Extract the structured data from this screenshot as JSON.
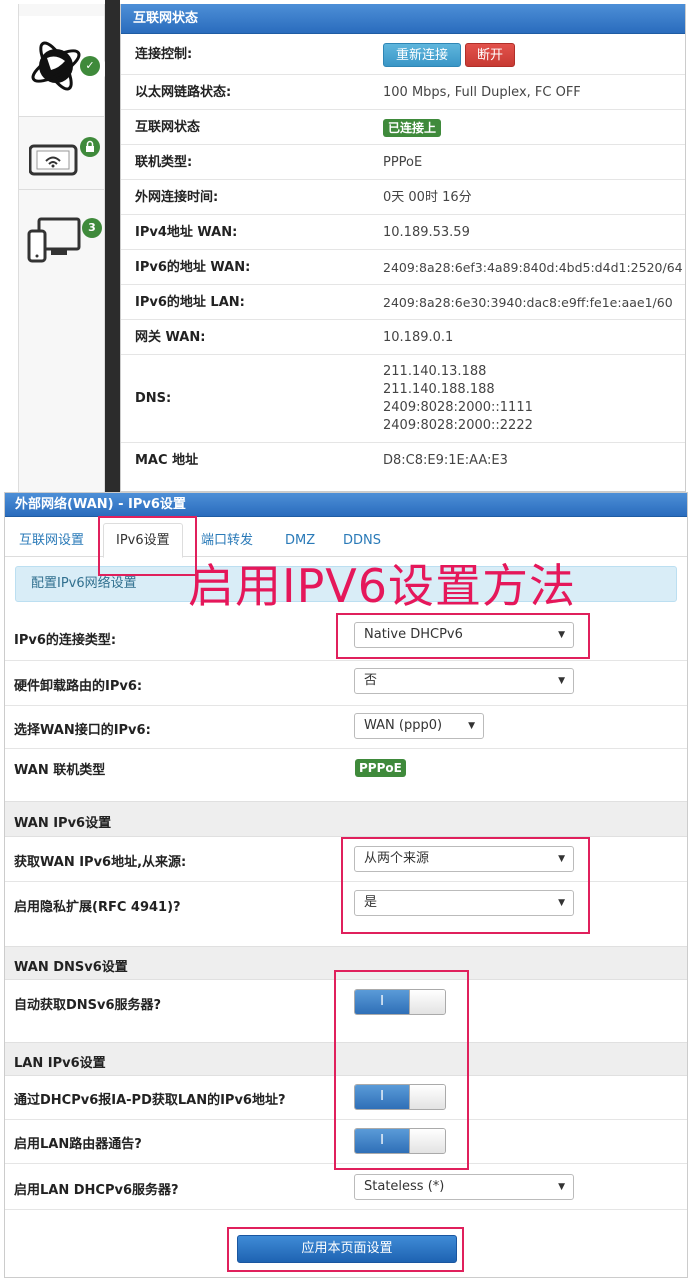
{
  "status": {
    "title": "互联网状态",
    "sidebar": [
      {
        "icon": "globe-icon",
        "badge": "✓"
      },
      {
        "icon": "wireless-tablet-icon",
        "badge": "lock"
      },
      {
        "icon": "devices-icon",
        "badge": "3"
      }
    ],
    "rows": {
      "connect_label": "连接控制:",
      "reconnect_btn": "重新连接",
      "disconnect_btn": "断开",
      "ethernet_label": "以太网链路状态:",
      "ethernet_value": "100 Mbps, Full Duplex, FC OFF",
      "internet_label": "互联网状态",
      "internet_value": "已连接上",
      "conn_type_label": "联机类型:",
      "conn_type_value": "PPPoE",
      "uptime_label": "外网连接时间:",
      "uptime_value": "0天 00时 16分",
      "ipv4_label": "IPv4地址 WAN:",
      "ipv4_value": "10.189.53.59",
      "ipv6_wan_label": "IPv6的地址 WAN:",
      "ipv6_wan_value": "2409:8a28:6ef3:4a89:840d:4bd5:d4d1:2520/64",
      "ipv6_lan_label": "IPv6的地址 LAN:",
      "ipv6_lan_value": "2409:8a28:6e30:3940:dac8:e9ff:fe1e:aae1/60",
      "gateway_label": "网关 WAN:",
      "gateway_value": "10.189.0.1",
      "dns_label": "DNS:",
      "dns_values": [
        "211.140.13.188",
        "211.140.188.188",
        "2409:8028:2000::1111",
        "2409:8028:2000::2222"
      ],
      "mac_label": "MAC 地址",
      "mac_value": "D8:C8:E9:1E:AA:E3"
    }
  },
  "wan": {
    "title": "外部网络(WAN) - IPv6设置",
    "tabs": [
      "互联网设置",
      "IPv6设置",
      "端口转发",
      "DMZ",
      "DDNS"
    ],
    "active_tab": "IPv6设置",
    "info": "配置IPv6网络设置",
    "overlay_title": "启用IPV6设置方法",
    "fields": {
      "conn_type_label": "IPv6的连接类型:",
      "conn_type_value": "Native DHCPv6",
      "hw_offload_label": "硬件卸载路由的IPv6:",
      "hw_offload_value": "否",
      "wan_iface_label": "选择WAN接口的IPv6:",
      "wan_iface_value": "WAN (ppp0)",
      "wan_type_label": "WAN 联机类型",
      "wan_type_value": "PPPoE",
      "wan_ipv6_section": "WAN IPv6设置",
      "get_addr_label": "获取WAN IPv6地址,从来源:",
      "get_addr_value": "从两个来源",
      "privacy_label": "启用隐私扩展(RFC 4941)?",
      "privacy_value": "是",
      "wan_dns_section": "WAN DNSv6设置",
      "auto_dns_label": "自动获取DNSv6服务器?",
      "lan_section": "LAN IPv6设置",
      "iapd_label": "通过DHCPv6报IA-PD获取LAN的IPv6地址?",
      "ra_label": "启用LAN路由器通告?",
      "lan_dhcp_label": "启用LAN DHCPv6服务器?",
      "lan_dhcp_value": "Stateless (*)",
      "toggle_on_text": "I"
    },
    "apply_btn": "应用本页面设置"
  },
  "colors": {
    "header_blue": "#2a6cbd",
    "badge_green": "#3f8a3b",
    "highlight": "#e0205c"
  }
}
